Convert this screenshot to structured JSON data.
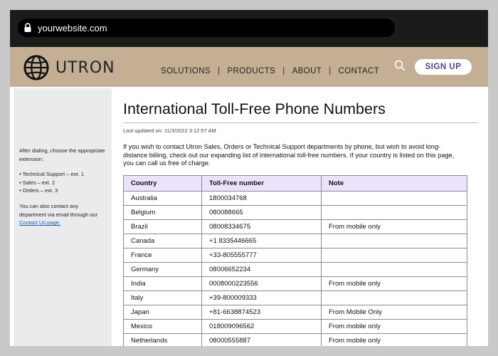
{
  "browser": {
    "url": "yourwebsite.com"
  },
  "header": {
    "logo_text": "UTRON",
    "nav": [
      "SOLUTIONS",
      "PRODUCTS",
      "ABOUT",
      "CONTACT"
    ],
    "nav_separator": "|",
    "signup_label": "SIGN UP"
  },
  "sidebar": {
    "intro": "After dialing, choose the appropriate extension:",
    "extensions": [
      "• Technical Support – ext. 1",
      "• Sales – ext. 2",
      "• Orders – ext. 3"
    ],
    "contact_text": "You can also contact any department via email through our ",
    "contact_link": "Contact Us page."
  },
  "main": {
    "title": "International Toll-Free Phone Numbers",
    "last_updated": "Last updated on: 11/3/2022 3:12:57 AM",
    "intro": "If you wish to contact Utron Sales, Orders or Technical Support departments by phone, but wish to avoid long-distance billing, check out our expanding list of international toll-free numbers. If your country is listed on this page, you can call us free of charge."
  },
  "table": {
    "headers": [
      "Country",
      "Toll-Free number",
      "Note"
    ],
    "rows": [
      [
        "Australia",
        "1800034768",
        ""
      ],
      [
        "Belgium",
        "080088665",
        ""
      ],
      [
        "Brazil",
        "08008334675",
        "From mobile only"
      ],
      [
        "Canada",
        "+1 8335446665",
        ""
      ],
      [
        "France",
        "+33-805555777",
        ""
      ],
      [
        "Germany",
        "08006652234",
        ""
      ],
      [
        "India",
        "0008000223556",
        "From mobile only"
      ],
      [
        "Italy",
        "+39-800009333",
        ""
      ],
      [
        "Japan",
        "+81-6638874523",
        "From Mobile Only"
      ],
      [
        "Mexico",
        "018009096562",
        "From mobile only"
      ],
      [
        "Netherlands",
        "08000555887",
        "From mobile only"
      ]
    ]
  },
  "colors": {
    "header_bg": "#c4af94",
    "browser_bg": "#1b1b1b",
    "sidebar_bg": "#eaebed",
    "table_header_bg": "#ebe3fb",
    "signup_text": "#5a3e8c",
    "link": "#1a5fb4"
  }
}
